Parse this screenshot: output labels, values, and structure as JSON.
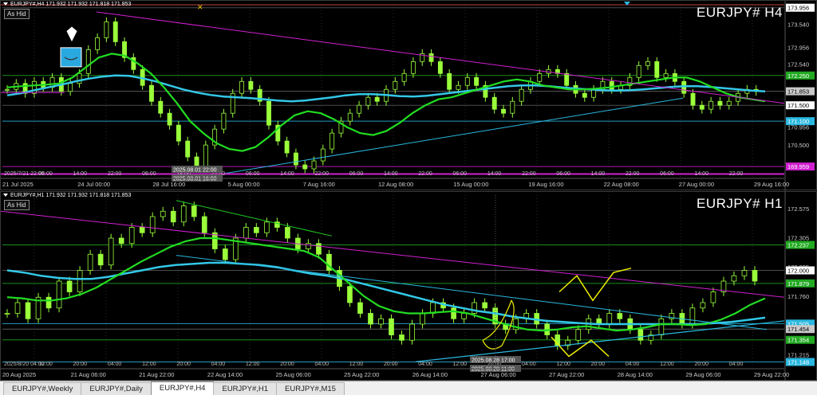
{
  "colors": {
    "background": "#000000",
    "candle": "#9aff3a",
    "ma_fast": "#22dd22",
    "ma_slow": "#33c8e8",
    "trend_magenta": "#d020d0",
    "trend_cyan": "#2ab8e0",
    "trend_green": "#22cc22",
    "drawing_yellow": "#f0f000",
    "level_green": "#1a8a1a",
    "level_gray": "#6e6e6e",
    "top_line": "#c04040"
  },
  "tabs": [
    {
      "label": "EURJPY#,Weekly",
      "active": false
    },
    {
      "label": "EURJPY#,Daily",
      "active": false
    },
    {
      "label": "EURJPY#,H4",
      "active": true
    },
    {
      "label": "EURJPY#,H1",
      "active": false
    },
    {
      "label": "EURJPY#,M15",
      "active": false
    }
  ],
  "charts": [
    {
      "id": "h4",
      "title": "EURJPY#,H4  171.932 171.932 171.818 171.853",
      "ashid": "As Hid",
      "symbol": "EURJPY# H4",
      "price_top": 174.05,
      "price_bottom": 169.7,
      "price_labels": [
        "173.956",
        "173.540",
        "172.956",
        "172.540",
        "172.250",
        "171.853",
        "171.500",
        "171.100",
        "170.956",
        "170.500",
        "170.000",
        "169.959"
      ],
      "price_label_values": [
        173.956,
        173.54,
        172.956,
        172.54,
        172.25,
        171.853,
        171.5,
        171.1,
        170.956,
        170.5,
        170.0,
        169.959
      ],
      "highlighted_prices": {
        "171.853": "#c8c8c8",
        "172.250": "#22aa22",
        "171.100": "#2ab8e0",
        "169.959": "#d020d0",
        "171.500": "#ffffff",
        "173.956": "#ffffff"
      },
      "time_labels": [
        "21 Jul 2025",
        "24 Jul 00:00",
        "28 Jul 16:00",
        "5 Aug 00:00",
        "7 Aug 16:00",
        "12 Aug 08:00",
        "15 Aug 00:00",
        "19 Aug 16:00",
        "22 Aug 08:00",
        "27 Aug 00:00",
        "29 Aug 16:00"
      ],
      "time_marker_labels": [
        "2025/7/21 22:00",
        "06:00",
        "14:00",
        "22:00",
        "06:00",
        "14:00",
        "22:00",
        "06:00",
        "14:00",
        "22:00",
        "06:00",
        "14:00",
        "22:00",
        "06:00",
        "14:00",
        "22:00",
        "06:00",
        "14:00",
        "22:00",
        "06:00",
        "14:00",
        "22:00"
      ],
      "crosshair_labels": [
        "2025.08.01 22:00",
        "2025.08.01 16:00"
      ],
      "close_series": [
        171.9,
        172.05,
        171.8,
        172.1,
        171.95,
        172.2,
        171.85,
        172.05,
        172.3,
        172.9,
        173.2,
        173.6,
        173.1,
        172.7,
        172.4,
        172.0,
        171.6,
        171.3,
        171.0,
        170.6,
        170.2,
        169.95,
        170.5,
        170.9,
        171.3,
        171.8,
        172.1,
        171.9,
        171.6,
        171.0,
        170.6,
        170.3,
        170.0,
        169.9,
        170.1,
        170.4,
        170.8,
        171.1,
        171.3,
        171.5,
        171.7,
        171.6,
        171.9,
        172.1,
        172.3,
        172.6,
        172.8,
        172.6,
        172.3,
        171.9,
        172.0,
        172.2,
        172.0,
        171.7,
        171.4,
        171.3,
        171.6,
        171.9,
        172.1,
        172.3,
        172.4,
        172.3,
        172.0,
        171.8,
        171.7,
        171.9,
        172.1,
        171.9,
        172.0,
        172.2,
        172.5,
        172.6,
        172.2,
        172.3,
        172.1,
        171.8,
        171.5,
        171.4,
        171.6,
        171.5,
        171.6,
        171.8,
        171.9,
        171.85
      ],
      "ma_fast": [
        171.95,
        171.98,
        172.0,
        172.02,
        172.05,
        172.2,
        172.45,
        172.7,
        172.8,
        172.75,
        172.55,
        172.3,
        171.95,
        171.55,
        171.1,
        170.8,
        170.55,
        170.4,
        170.35,
        170.45,
        170.7,
        171.0,
        171.25,
        171.35,
        171.3,
        171.15,
        170.95,
        170.8,
        170.75,
        170.85,
        171.05,
        171.3,
        171.5,
        171.65,
        171.7,
        171.8,
        171.9,
        172.0,
        172.1,
        172.15,
        172.1,
        172.0,
        171.95,
        171.9,
        171.9,
        171.92,
        171.95,
        172.0,
        172.05,
        172.1,
        172.15,
        172.2,
        172.2,
        172.1,
        171.95,
        171.8,
        171.7,
        171.65,
        171.6
      ],
      "ma_slow": [
        171.75,
        171.8,
        171.88,
        171.95,
        172.02,
        172.1,
        172.17,
        172.22,
        172.25,
        172.24,
        172.18,
        172.1,
        172.0,
        171.9,
        171.82,
        171.76,
        171.72,
        171.7,
        171.68,
        171.65,
        171.62,
        171.6,
        171.62,
        171.66,
        171.7,
        171.75,
        171.78,
        171.78,
        171.76,
        171.73,
        171.72,
        171.74,
        171.78,
        171.82,
        171.86,
        171.9,
        171.94,
        171.98,
        172.0,
        172.0,
        171.98,
        171.95,
        171.92,
        171.9,
        171.88,
        171.87,
        171.88,
        171.9,
        171.93,
        171.96,
        171.98,
        171.98,
        171.96,
        171.93,
        171.9,
        171.87,
        171.85
      ]
    },
    {
      "id": "h1",
      "title": "EURJPY#,H1  171.932 171.932 171.818 171.853",
      "ashid": "As Hid",
      "symbol": "EURJPY# H1",
      "price_top": 172.7,
      "price_bottom": 171.1,
      "price_labels": [
        "172.575",
        "172.305",
        "172.237",
        "172.035",
        "172.000",
        "171.879",
        "171.760",
        "171.505",
        "171.454",
        "171.354",
        "171.215",
        "171.148"
      ],
      "price_label_values": [
        172.575,
        172.305,
        172.237,
        172.035,
        172.0,
        171.879,
        171.76,
        171.505,
        171.454,
        171.354,
        171.215,
        171.148
      ],
      "highlighted_prices": {
        "172.237": "#22aa22",
        "172.000": "#ffffff",
        "171.879": "#22aa22",
        "171.505": "#2ab8e0",
        "171.454": "#c8c8c8",
        "171.354": "#22aa22",
        "171.148": "#2ab8e0"
      },
      "time_labels": [
        "20 Aug 2025",
        "21 Aug 06:00",
        "21 Aug 22:00",
        "22 Aug 14:00",
        "25 Aug 06:00",
        "25 Aug 22:00",
        "26 Aug 14:00",
        "27 Aug 06:00",
        "27 Aug 22:00",
        "28 Aug 14:00",
        "29 Aug 06:00",
        "29 Aug 22:00"
      ],
      "time_marker_labels": [
        "2025/8/20 04:00",
        "12:00",
        "20:00",
        "04:00",
        "12:00",
        "20:00",
        "04:00",
        "12:00",
        "20:00",
        "04:00",
        "12:00",
        "20:00",
        "04:00",
        "12:00",
        "20:00",
        "04:00",
        "12:00",
        "20:00",
        "04:00",
        "12:00",
        "20:00",
        "04:00"
      ],
      "crosshair_labels": [
        "2025.08.28 17:00",
        "2025.08.28 11:00"
      ],
      "close_series": [
        171.6,
        171.7,
        171.55,
        171.75,
        171.65,
        171.9,
        171.8,
        172.0,
        172.15,
        172.05,
        172.3,
        172.25,
        172.4,
        172.35,
        172.5,
        172.55,
        172.45,
        172.6,
        172.5,
        172.35,
        172.2,
        172.1,
        172.3,
        172.4,
        172.35,
        172.45,
        172.4,
        172.3,
        172.2,
        172.25,
        172.15,
        172.0,
        171.85,
        171.7,
        171.6,
        171.5,
        171.55,
        171.4,
        171.35,
        171.5,
        171.6,
        171.7,
        171.65,
        171.55,
        171.6,
        171.7,
        171.65,
        171.5,
        171.45,
        171.55,
        171.6,
        171.5,
        171.4,
        171.3,
        171.35,
        171.45,
        171.55,
        171.5,
        171.6,
        171.55,
        171.45,
        171.35,
        171.4,
        171.55,
        171.6,
        171.5,
        171.65,
        171.7,
        171.8,
        171.9,
        171.95,
        172.0,
        171.9
      ],
      "ma_fast": [
        171.75,
        171.74,
        171.72,
        171.72,
        171.74,
        171.78,
        171.84,
        171.92,
        172.0,
        172.08,
        172.15,
        172.22,
        172.27,
        172.3,
        172.3,
        172.28,
        172.26,
        172.24,
        172.22,
        172.2,
        172.18,
        172.12,
        172.0,
        171.88,
        171.76,
        171.67,
        171.62,
        171.6,
        171.6,
        171.61,
        171.62,
        171.6,
        171.56,
        171.52,
        171.48,
        171.45,
        171.44,
        171.45,
        171.47,
        171.48,
        171.46,
        171.44,
        171.45,
        171.47,
        171.5,
        171.5,
        171.49,
        171.5,
        171.54,
        171.6,
        171.68,
        171.74
      ],
      "ma_slow": [
        172.0,
        171.98,
        171.95,
        171.93,
        171.92,
        171.92,
        171.94,
        171.97,
        172.0,
        172.03,
        172.05,
        172.06,
        172.07,
        172.07,
        172.06,
        172.05,
        172.03,
        172.0,
        171.97,
        171.95,
        171.92,
        171.88,
        171.84,
        171.8,
        171.76,
        171.72,
        171.68,
        171.65,
        171.62,
        171.6,
        171.57,
        171.55,
        171.53,
        171.52,
        171.51,
        171.5,
        171.5,
        171.5,
        171.5,
        171.5,
        171.5,
        171.5,
        171.51,
        171.52,
        171.54,
        171.56
      ]
    }
  ]
}
